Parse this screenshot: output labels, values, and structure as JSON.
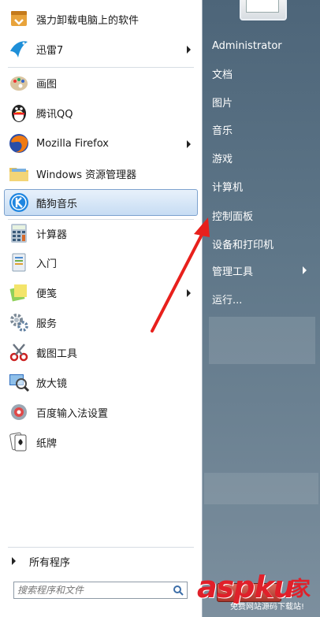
{
  "programs": [
    {
      "label": "强力卸载电脑上的软件",
      "icon": "uninstall-icon",
      "has_submenu": false
    },
    {
      "label": "迅雷7",
      "icon": "thunder-bird-icon",
      "has_submenu": true
    },
    {
      "label": "画图",
      "icon": "paint-palette-icon",
      "has_submenu": false
    },
    {
      "label": "腾讯QQ",
      "icon": "qq-penguin-icon",
      "has_submenu": false
    },
    {
      "label": "Mozilla Firefox",
      "icon": "firefox-icon",
      "has_submenu": true
    },
    {
      "label": "Windows 资源管理器",
      "icon": "folder-icon",
      "has_submenu": false
    },
    {
      "label": "酷狗音乐",
      "icon": "kugou-icon",
      "has_submenu": false,
      "selected": true
    },
    {
      "label": "计算器",
      "icon": "calculator-icon",
      "has_submenu": false
    },
    {
      "label": "入门",
      "icon": "getting-started-icon",
      "has_submenu": false
    },
    {
      "label": "便笺",
      "icon": "sticky-note-icon",
      "has_submenu": true
    },
    {
      "label": "服务",
      "icon": "gear-icon",
      "has_submenu": false
    },
    {
      "label": "截图工具",
      "icon": "scissors-icon",
      "has_submenu": false
    },
    {
      "label": "放大镜",
      "icon": "magnifier-icon",
      "has_submenu": false
    },
    {
      "label": "百度输入法设置",
      "icon": "settings-wheel-icon",
      "has_submenu": false
    },
    {
      "label": "纸牌",
      "icon": "playing-card-icon",
      "has_submenu": false
    }
  ],
  "all_programs_label": "所有程序",
  "search": {
    "placeholder": "搜索程序和文件"
  },
  "right_menu": [
    {
      "label": "Administrator",
      "has_submenu": false
    },
    {
      "label": "文档",
      "has_submenu": false
    },
    {
      "label": "图片",
      "has_submenu": false
    },
    {
      "label": "音乐",
      "has_submenu": false
    },
    {
      "label": "游戏",
      "has_submenu": false
    },
    {
      "label": "计算机",
      "has_submenu": false
    },
    {
      "label": "控制面板",
      "has_submenu": false
    },
    {
      "label": "设备和打印机",
      "has_submenu": false
    },
    {
      "label": "管理工具",
      "has_submenu": true
    },
    {
      "label": "运行...",
      "has_submenu": false
    }
  ],
  "annotation": {
    "color": "#e8201c"
  },
  "colors": {
    "selected_bg": "#c6dcf3",
    "right_pane": "#5e7688",
    "watermark": "#e0202a"
  },
  "watermark": {
    "logo": "aspku",
    "jia": "家",
    "subtitle": "免费网站源码下载站!"
  }
}
